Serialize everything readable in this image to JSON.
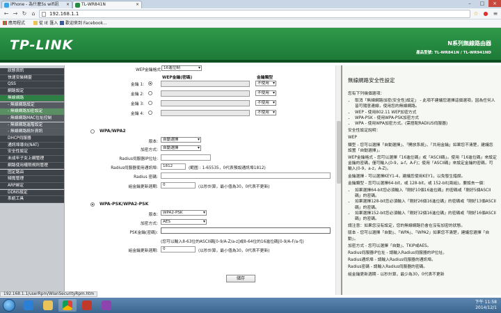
{
  "browser": {
    "tabs": [
      {
        "label": "iPhone - 為什麼5s wifi訊"
      },
      {
        "label": "TL-WR841N"
      }
    ],
    "url": "192.168.1.1",
    "bookmarks": [
      {
        "label": "應用程式"
      },
      {
        "label": "從 IE 匯入"
      },
      {
        "label": "歡迎來到 Facebook..."
      }
    ],
    "status_url": "192.168.1.1/userRpm/WlanSecurityRpm.htm"
  },
  "banner": {
    "logo": "TP-LINK",
    "series": "N系列無線路由器",
    "model": "產品型號: TL-WR841N / TL-WR941ND"
  },
  "sidebar": {
    "items": [
      {
        "label": "狀態資訊",
        "level": 1
      },
      {
        "label": "快速安裝精靈",
        "level": 1
      },
      {
        "label": "QSS",
        "level": 1
      },
      {
        "label": "網路設定",
        "level": 1
      },
      {
        "label": "無線網路",
        "level": 1,
        "selected": true
      },
      {
        "label": "- 無線網路設定",
        "level": 2
      },
      {
        "label": "- 無線網路加密設定",
        "level": 2,
        "selected": true
      },
      {
        "label": "- 無線網路MAC位址控制",
        "level": 2
      },
      {
        "label": "- 無線網路進階設定",
        "level": 2
      },
      {
        "label": "- 無線網路統計資訊",
        "level": 2
      },
      {
        "label": "DHCP伺服器",
        "level": 1
      },
      {
        "label": "通訊埠導向(NAT)",
        "level": 1
      },
      {
        "label": "安全性設定",
        "level": 1
      },
      {
        "label": "未成年子女上網管理",
        "level": 1
      },
      {
        "label": "網路使用權限規則管理",
        "level": 1
      },
      {
        "label": "固定路由",
        "level": 1
      },
      {
        "label": "頻寬管理",
        "level": 1
      },
      {
        "label": "ARP綁定",
        "level": 1
      },
      {
        "label": "DDNS設定",
        "level": 1
      },
      {
        "label": "系統工具",
        "level": 1
      }
    ]
  },
  "wep": {
    "format_label": "WEP金鑰格式:",
    "format_value": "16進位制",
    "col_key": "WEP金鑰(密碼)",
    "col_type": "金鑰類型",
    "keys": [
      {
        "label": "金鑰 1:",
        "type": "不使用",
        "selected": true
      },
      {
        "label": "金鑰 2:",
        "type": "不使用",
        "selected": false
      },
      {
        "label": "金鑰 3:",
        "type": "不使用",
        "selected": false
      },
      {
        "label": "金鑰 4:",
        "type": "不使用",
        "selected": false
      }
    ]
  },
  "wpa": {
    "title": "WPA/WPA2",
    "version_label": "版本:",
    "version_value": "自動選擇",
    "encrypt_label": "加密方式:",
    "encrypt_value": "自動選擇",
    "radius_ip_label": "Radius伺服器IP位址:",
    "radius_ip_value": "",
    "radius_port_label": "Radius伺服器使用通訊埠:",
    "radius_port_value": "1812",
    "radius_port_hint": "(範圍 : 1-65535，0代表預設通訊埠1812)",
    "radius_pwd_label": "Radius 密碼:",
    "radius_pwd_value": "",
    "group_key_label": "組金鑰更新週期:",
    "group_key_value": "0",
    "group_key_hint": "(以秒計算，最小值為30，0代表不更新)"
  },
  "psk": {
    "title": "WPA-PSK/WPA2-PSK",
    "version_label": "版本:",
    "version_value": "WPA2-PSK",
    "encrypt_label": "加密方式:",
    "encrypt_value": "AES",
    "psk_label": "PSK金鑰(密碼):",
    "psk_value": "",
    "psk_hint": "(您可以輸入8-63位的ASCII碼[0-9/A-Z/a-z]或8-64位的16進位碼[0-9/A-F/a-f])",
    "group_key_label": "組金鑰更新週期:",
    "group_key_value": "0",
    "group_key_hint": "(以秒計算，最小值為30，0代表不更新)"
  },
  "save_label": "儲存",
  "help": {
    "title": "無線網路安全性設定",
    "intro": "您有下列幾個選項：",
    "options": [
      "取消「無線網路加密(安全性)設定」 - 此項不建議您選擇這個選項，因為任何人皆可隨意連線，使用您的無線網路。",
      "WEP - 使用802.11 WEP加密方式",
      "WPA-PSK - 使用WPA-PSK加密方式",
      "WPA - 使用WPA加密方式。(需搭配RADIUS伺服器)"
    ],
    "sec_label": "安全性設定說明：",
    "wep_head": "WEP",
    "p1": "類型 - 您可以選擇「自動選擇」、「開放系統」、「共用金鑰」如果您不清楚，建議您設置「自動選擇」。",
    "p2": "WEP金鑰格式 - 您可以選擇「16進位碼」或「ASCII碼」。使用「16進位碼」來設定金鑰的密碼，僅可輸入(0-9，a-f，A-F)；使用「ASCII碼」來設定金鑰的密碼，可輸入(0-9，a-z，A-Z)。",
    "p3": "金鑰選擇 - 可以選擇KEY1-4，建議您使用KEY1，以免發生錯誤。",
    "p4": "金鑰類型 - 您可以選擇64-bit，或 128-bit，或 152-bit(兩組)，要設去一個：",
    "bits": [
      "如果選擇64-bit您必須輸入「剛好10個16進位碼」的密碼或「剛好5個ASCII碼」的密碼。",
      "如果選擇128-bit您必須輸入「剛好26個16進位碼」的密碼或「剛好13個ASCII碼」的密碼。",
      "如果選擇152-bit您必須輸入「剛好32個16進位碼」的密碼或「剛好16個ASCII碼」的密碼。"
    ],
    "p5": "請注意：如果您沒有設定，您的無線網路仍會在沒有加密的狀態。",
    "p6": "版本 - 您可以選擇「自動」、「WPA」、「WPA2」如果您不清楚，建議您選擇「自動」。",
    "p7": "加密方式 - 您可以選擇「自動」、TKIP或AES。",
    "p8": "Radius伺服器IP位址 - 請輸入Radius伺服器的IP位址。",
    "p9": "Radius通訊埠 - 請輸入Radius伺服器的通訊埠。",
    "p10": "Radius密碼 - 請輸入Radius伺服器的密碼。",
    "p11": "組金鑰更新週期 - 以秒計算，最少為30，0代表不更新"
  },
  "tray": {
    "time": "下午 11:58",
    "date": "2014/12/1"
  },
  "colors": {
    "brand_green": "#2d8a43",
    "sidebar_dark": "#3d4148"
  }
}
